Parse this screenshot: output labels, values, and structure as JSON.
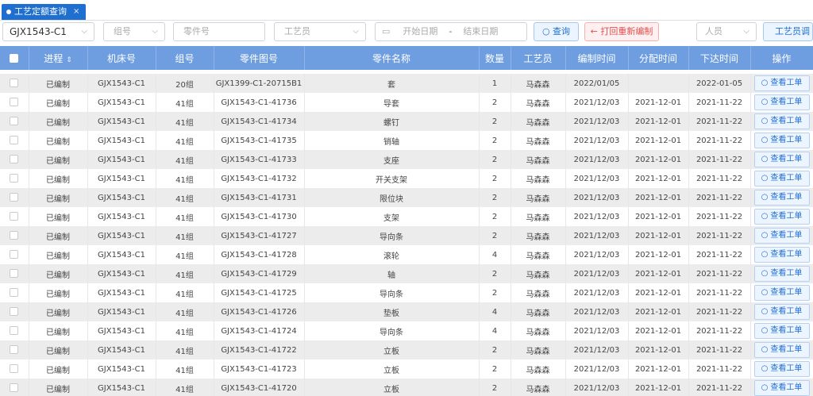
{
  "tab": {
    "label": "工艺定额查询",
    "close": "×"
  },
  "filters": {
    "machine_value": "GJX1543-C1",
    "group_placeholder": "组号",
    "part_placeholder": "零件号",
    "technician_placeholder": "工艺员",
    "start_date_placeholder": "开始日期",
    "date_separator": "-",
    "end_date_placeholder": "结束日期",
    "query_label": "查询",
    "back_label": "打回重新编制",
    "person_placeholder": "人员",
    "adjust_label": "工艺员调整"
  },
  "table": {
    "columns": [
      "进程",
      "机床号",
      "组号",
      "零件图号",
      "零件名称",
      "数量",
      "工艺员",
      "编制时间",
      "分配时间",
      "下达时间",
      "操作"
    ],
    "view_label": "查看工单",
    "rows": [
      {
        "status": "已编制",
        "machine": "GJX1543-C1",
        "group": "20组",
        "drawing": "GJX1399-C1-20715B1",
        "name": "套",
        "qty": "1",
        "tech": "马森森",
        "made": "2022/01/05",
        "assigned": "",
        "issued": "2022-01-05"
      },
      {
        "status": "已编制",
        "machine": "GJX1543-C1",
        "group": "41组",
        "drawing": "GJX1543-C1-41736",
        "name": "导套",
        "qty": "2",
        "tech": "马森森",
        "made": "2021/12/03",
        "assigned": "2021-12-01",
        "issued": "2021-11-22"
      },
      {
        "status": "已编制",
        "machine": "GJX1543-C1",
        "group": "41组",
        "drawing": "GJX1543-C1-41734",
        "name": "螺钉",
        "qty": "2",
        "tech": "马森森",
        "made": "2021/12/03",
        "assigned": "2021-12-01",
        "issued": "2021-11-22"
      },
      {
        "status": "已编制",
        "machine": "GJX1543-C1",
        "group": "41组",
        "drawing": "GJX1543-C1-41735",
        "name": "销轴",
        "qty": "2",
        "tech": "马森森",
        "made": "2021/12/03",
        "assigned": "2021-12-01",
        "issued": "2021-11-22"
      },
      {
        "status": "已编制",
        "machine": "GJX1543-C1",
        "group": "41组",
        "drawing": "GJX1543-C1-41733",
        "name": "支座",
        "qty": "2",
        "tech": "马森森",
        "made": "2021/12/03",
        "assigned": "2021-12-01",
        "issued": "2021-11-22"
      },
      {
        "status": "已编制",
        "machine": "GJX1543-C1",
        "group": "41组",
        "drawing": "GJX1543-C1-41732",
        "name": "开关支架",
        "qty": "2",
        "tech": "马森森",
        "made": "2021/12/03",
        "assigned": "2021-12-01",
        "issued": "2021-11-22"
      },
      {
        "status": "已编制",
        "machine": "GJX1543-C1",
        "group": "41组",
        "drawing": "GJX1543-C1-41731",
        "name": "限位块",
        "qty": "2",
        "tech": "马森森",
        "made": "2021/12/03",
        "assigned": "2021-12-01",
        "issued": "2021-11-22"
      },
      {
        "status": "已编制",
        "machine": "GJX1543-C1",
        "group": "41组",
        "drawing": "GJX1543-C1-41730",
        "name": "支架",
        "qty": "2",
        "tech": "马森森",
        "made": "2021/12/03",
        "assigned": "2021-12-01",
        "issued": "2021-11-22"
      },
      {
        "status": "已编制",
        "machine": "GJX1543-C1",
        "group": "41组",
        "drawing": "GJX1543-C1-41727",
        "name": "导向条",
        "qty": "2",
        "tech": "马森森",
        "made": "2021/12/03",
        "assigned": "2021-12-01",
        "issued": "2021-11-22"
      },
      {
        "status": "已编制",
        "machine": "GJX1543-C1",
        "group": "41组",
        "drawing": "GJX1543-C1-41728",
        "name": "滚轮",
        "qty": "4",
        "tech": "马森森",
        "made": "2021/12/03",
        "assigned": "2021-12-01",
        "issued": "2021-11-22"
      },
      {
        "status": "已编制",
        "machine": "GJX1543-C1",
        "group": "41组",
        "drawing": "GJX1543-C1-41729",
        "name": "轴",
        "qty": "2",
        "tech": "马森森",
        "made": "2021/12/03",
        "assigned": "2021-12-01",
        "issued": "2021-11-22"
      },
      {
        "status": "已编制",
        "machine": "GJX1543-C1",
        "group": "41组",
        "drawing": "GJX1543-C1-41725",
        "name": "导向条",
        "qty": "2",
        "tech": "马森森",
        "made": "2021/12/03",
        "assigned": "2021-12-01",
        "issued": "2021-11-22"
      },
      {
        "status": "已编制",
        "machine": "GJX1543-C1",
        "group": "41组",
        "drawing": "GJX1543-C1-41726",
        "name": "垫板",
        "qty": "4",
        "tech": "马森森",
        "made": "2021/12/03",
        "assigned": "2021-12-01",
        "issued": "2021-11-22"
      },
      {
        "status": "已编制",
        "machine": "GJX1543-C1",
        "group": "41组",
        "drawing": "GJX1543-C1-41724",
        "name": "导向条",
        "qty": "4",
        "tech": "马森森",
        "made": "2021/12/03",
        "assigned": "2021-12-01",
        "issued": "2021-11-22"
      },
      {
        "status": "已编制",
        "machine": "GJX1543-C1",
        "group": "41组",
        "drawing": "GJX1543-C1-41722",
        "name": "立板",
        "qty": "2",
        "tech": "马森森",
        "made": "2021/12/03",
        "assigned": "2021-12-01",
        "issued": "2021-11-22"
      },
      {
        "status": "已编制",
        "machine": "GJX1543-C1",
        "group": "41组",
        "drawing": "GJX1543-C1-41723",
        "name": "立板",
        "qty": "2",
        "tech": "马森森",
        "made": "2021/12/03",
        "assigned": "2021-12-01",
        "issued": "2021-11-22"
      },
      {
        "status": "已编制",
        "machine": "GJX1543-C1",
        "group": "41组",
        "drawing": "GJX1543-C1-41720",
        "name": "立板",
        "qty": "2",
        "tech": "马森森",
        "made": "2021/12/03",
        "assigned": "2021-12-01",
        "issued": "2021-11-22"
      }
    ]
  },
  "icons": {
    "search": "search-icon",
    "back": "arrow-left-icon",
    "calendar": "calendar-icon",
    "chevron": "chevron-down-icon",
    "sort": "sort-icon"
  },
  "colors": {
    "primary": "#1f6fd1",
    "header": "#6e9ee0",
    "danger": "#e05050",
    "stripe": "#ececec"
  }
}
